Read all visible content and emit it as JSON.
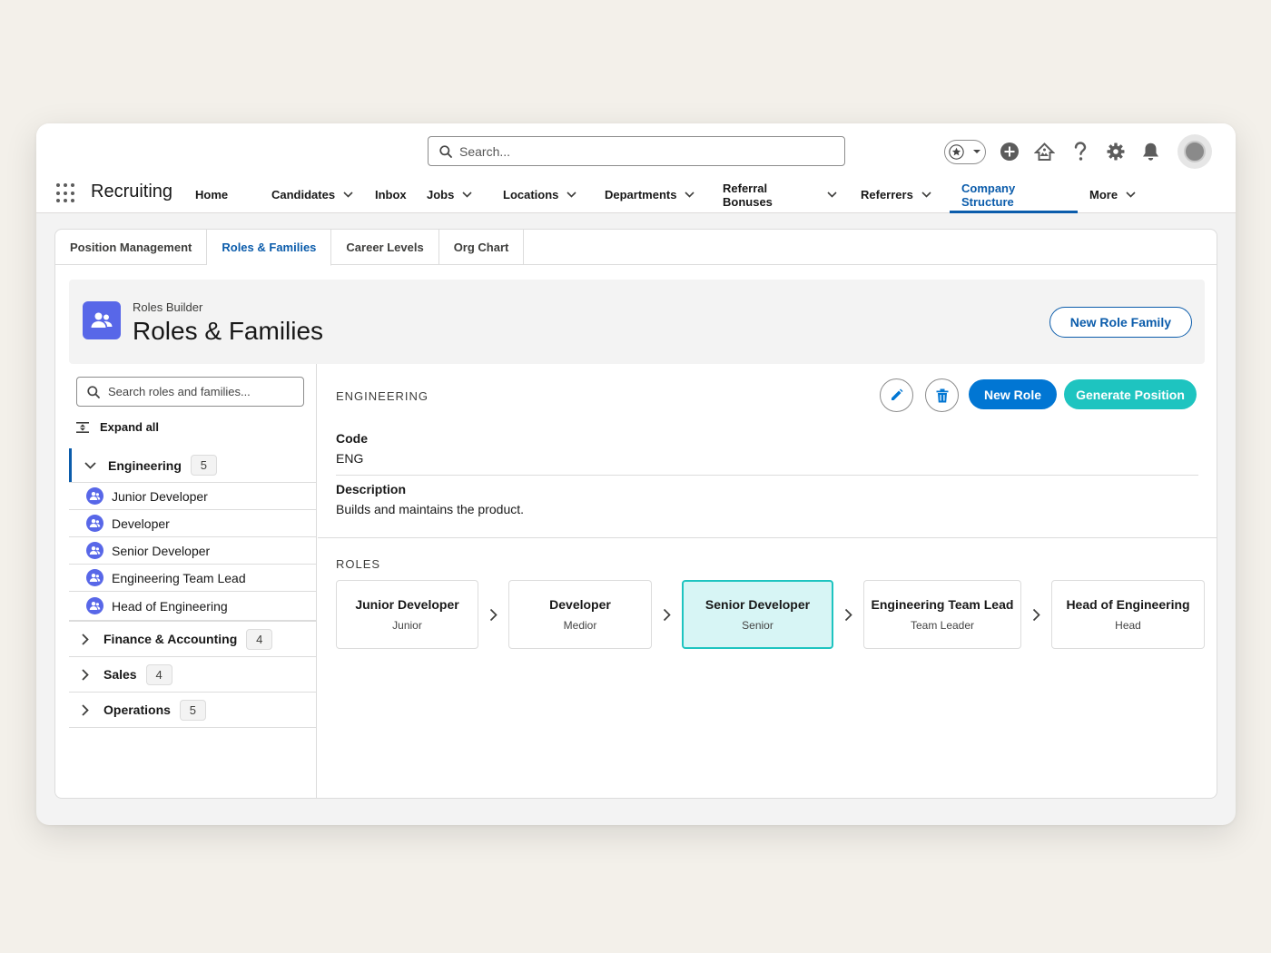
{
  "header": {
    "search_placeholder": "Search...",
    "icons": [
      "star-icon",
      "chevron-down-icon",
      "add-icon",
      "trailhead-icon",
      "help-icon",
      "gear-icon",
      "bell-icon",
      "avatar"
    ]
  },
  "app": {
    "name": "Recruiting",
    "nav": [
      {
        "label": "Home",
        "has_menu": false
      },
      {
        "label": "Candidates",
        "has_menu": true
      },
      {
        "label": "Inbox",
        "has_menu": false
      },
      {
        "label": "Jobs",
        "has_menu": true
      },
      {
        "label": "Locations",
        "has_menu": true
      },
      {
        "label": "Departments",
        "has_menu": true
      },
      {
        "label": "Referral Bonuses",
        "has_menu": true
      },
      {
        "label": "Referrers",
        "has_menu": true
      },
      {
        "label": "Company Structure",
        "has_menu": false,
        "active": true
      },
      {
        "label": "More",
        "has_menu": true
      }
    ]
  },
  "tabs": [
    {
      "label": "Position Management"
    },
    {
      "label": "Roles & Families",
      "active": true
    },
    {
      "label": "Career Levels"
    },
    {
      "label": "Org Chart"
    }
  ],
  "page_header": {
    "eyebrow": "Roles Builder",
    "title": "Roles & Families",
    "new_family_label": "New Role Family"
  },
  "sidebar": {
    "search_placeholder": "Search roles and families...",
    "expand_all_label": "Expand all",
    "families": [
      {
        "name": "Engineering",
        "count": "5",
        "expanded": true,
        "roles": [
          "Junior Developer",
          "Developer",
          "Senior Developer",
          "Engineering Team Lead",
          "Head of Engineering"
        ]
      },
      {
        "name": "Finance & Accounting",
        "count": "4",
        "expanded": false
      },
      {
        "name": "Sales",
        "count": "4",
        "expanded": false
      },
      {
        "name": "Operations",
        "count": "5",
        "expanded": false
      }
    ]
  },
  "detail": {
    "family_label": "ENGINEERING",
    "new_role_label": "New Role",
    "generate_label": "Generate Position",
    "code_label": "Code",
    "code_value": "ENG",
    "description_label": "Description",
    "description_value": "Builds and maintains the product.",
    "roles_label": "ROLES",
    "roles": [
      {
        "title": "Junior Developer",
        "level": "Junior"
      },
      {
        "title": "Developer",
        "level": "Medior"
      },
      {
        "title": "Senior Developer",
        "level": "Senior",
        "selected": true
      },
      {
        "title": "Engineering Team Lead",
        "level": "Team Leader"
      },
      {
        "title": "Head of Engineering",
        "level": "Head"
      }
    ]
  },
  "colors": {
    "brand": "#0b5cab",
    "primary_button": "#0176d3",
    "teal_button": "#1ec4c0",
    "selected_card_bg": "#d7f5f5",
    "family_icon": "#5867e8"
  }
}
